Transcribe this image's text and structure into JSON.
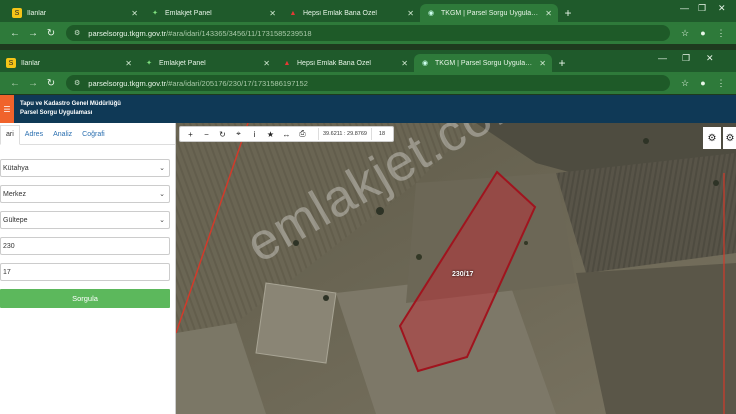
{
  "browser_outer": {
    "tabs": [
      {
        "icon": "S",
        "label": "İlanlar",
        "active": false
      },
      {
        "icon": "✦",
        "label": "Emlakjet Panel",
        "active": false
      },
      {
        "icon": "▲",
        "label": "Hepsi Emlak Bana Özel",
        "active": false
      },
      {
        "icon": "◉",
        "label": "TKGM | Parsel Sorgu Uygulaması",
        "active": true
      }
    ],
    "url_host": "parselsorgu.tkgm.gov.tr",
    "url_path": "/#ara/idari/143365/3456/11/1731585239518"
  },
  "browser_inner": {
    "tabs": [
      {
        "icon": "S",
        "label": "İlanlar",
        "active": false
      },
      {
        "icon": "✦",
        "label": "Emlakjet Panel",
        "active": false
      },
      {
        "icon": "▲",
        "label": "Hepsi Emlak Bana Özel",
        "active": false
      },
      {
        "icon": "◉",
        "label": "TKGM | Parsel Sorgu Uygulaması",
        "active": true
      }
    ],
    "url_host": "parselsorgu.tkgm.gov.tr",
    "url_path": "/#ara/idari/205176/230/17/1731586197152"
  },
  "app": {
    "header_line1": "Tapu ve Kadastro Genel Müdürlüğü",
    "header_line2": "Parsel Sorgu Uygulaması",
    "panel_tabs": [
      "ari",
      "Adres",
      "Analiz",
      "Coğrafi"
    ],
    "selects": [
      "Kütahya",
      "Merkez",
      "Gültepe"
    ],
    "inputs": [
      "230",
      "17"
    ],
    "query_button": "Sorgula"
  },
  "map": {
    "coords": "39.6211 : 29.8769",
    "zoom": "18",
    "parcel_label": "230/17",
    "watermark": "emlakjet.com",
    "parcel_color": "#a0141e"
  }
}
